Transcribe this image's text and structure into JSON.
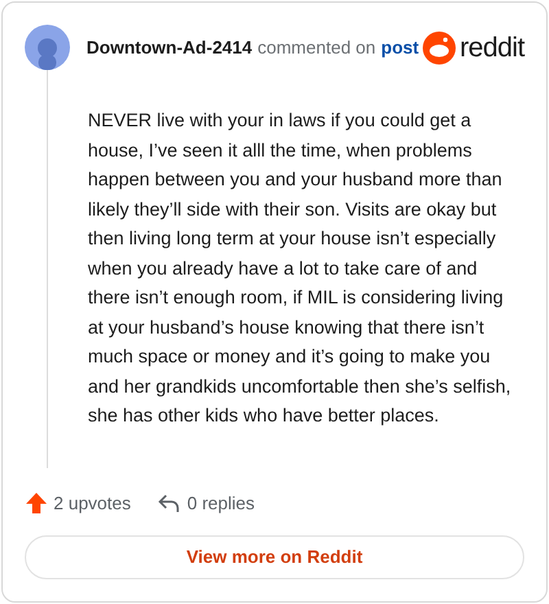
{
  "comment": {
    "author": "Downtown-Ad-2414",
    "action": "commented on",
    "link": "post",
    "brand": "reddit",
    "body": "NEVER live with your in laws if you could get a house, I’ve seen it alll the time, when problems happen between you and your husband more than likely they’ll side with their son. Visits are okay but then living long term at your house isn’t especially when you already have a lot to take care of and there isn’t enough room, if MIL is considering living at your husband’s house knowing that there isn’t much space or money and it’s going to make you and her grandkids uncomfortable then she’s selfish, she has other kids who have better places."
  },
  "footer": {
    "upvotes": "2 upvotes",
    "replies": "0 replies"
  },
  "button": "View more on Reddit"
}
